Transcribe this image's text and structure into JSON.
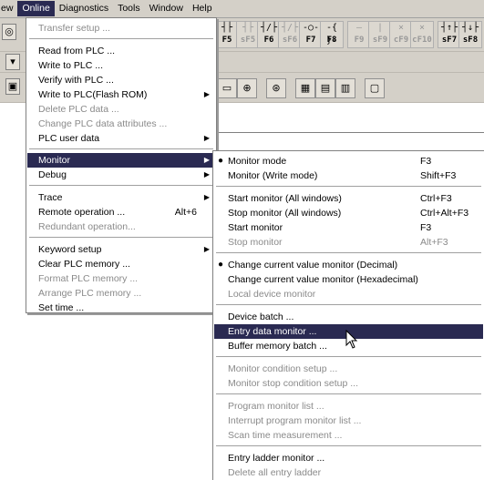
{
  "menubar": {
    "items": [
      {
        "label": "ew"
      },
      {
        "label": "Online"
      },
      {
        "label": "Diagnostics"
      },
      {
        "label": "Tools"
      },
      {
        "label": "Window"
      },
      {
        "label": "Help"
      }
    ]
  },
  "toolbar": {
    "function_keys": [
      {
        "symbol": "┤├",
        "label": "F5"
      },
      {
        "symbol": "┤├",
        "label": "sF5"
      },
      {
        "symbol": "┤/├",
        "label": "F6"
      },
      {
        "symbol": "┤/├",
        "label": "sF6"
      },
      {
        "symbol": "-○-",
        "label": "F7"
      },
      {
        "symbol": "-{ }-",
        "label": "F8"
      },
      {
        "symbol": "—",
        "label": "F9"
      },
      {
        "symbol": "|",
        "label": "sF9"
      },
      {
        "symbol": "⨯",
        "label": "cF9"
      },
      {
        "symbol": "⨯",
        "label": "cF10"
      },
      {
        "symbol": "┤↑├",
        "label": "sF7"
      },
      {
        "symbol": "┤↓├",
        "label": "sF8"
      }
    ]
  },
  "online_menu": {
    "items": [
      {
        "label": "Transfer setup ...",
        "enabled": false
      },
      {
        "label": "Read from PLC ...",
        "enabled": true
      },
      {
        "label": "Write to PLC ...",
        "enabled": true
      },
      {
        "label": "Verify with PLC ...",
        "enabled": true
      },
      {
        "label": "Write to PLC(Flash ROM)",
        "enabled": true,
        "submenu": true
      },
      {
        "label": "Delete PLC data ...",
        "enabled": false
      },
      {
        "label": "Change PLC data attributes ...",
        "enabled": false
      },
      {
        "label": "PLC user data",
        "enabled": true,
        "submenu": true
      },
      {
        "label": "Monitor",
        "enabled": true,
        "submenu": true,
        "highlighted": true
      },
      {
        "label": "Debug",
        "enabled": true,
        "submenu": true
      },
      {
        "label": "Trace",
        "enabled": true,
        "submenu": true
      },
      {
        "label": "Remote operation ...",
        "enabled": true,
        "shortcut": "Alt+6"
      },
      {
        "label": "Redundant operation...",
        "enabled": false
      },
      {
        "label": "Keyword setup",
        "enabled": true,
        "submenu": true
      },
      {
        "label": "Clear PLC memory ...",
        "enabled": true
      },
      {
        "label": "Format PLC memory ...",
        "enabled": false
      },
      {
        "label": "Arrange PLC memory ...",
        "enabled": false
      },
      {
        "label": "Set time ...",
        "enabled": true
      }
    ]
  },
  "monitor_menu": {
    "items": [
      {
        "label": "Monitor mode",
        "shortcut": "F3",
        "enabled": true,
        "checked": true
      },
      {
        "label": "Monitor (Write mode)",
        "shortcut": "Shift+F3",
        "enabled": true
      },
      {
        "label": "Start monitor (All windows)",
        "shortcut": "Ctrl+F3",
        "enabled": true
      },
      {
        "label": "Stop monitor (All windows)",
        "shortcut": "Ctrl+Alt+F3",
        "enabled": true
      },
      {
        "label": "Start monitor",
        "shortcut": "F3",
        "enabled": true
      },
      {
        "label": "Stop monitor",
        "shortcut": "Alt+F3",
        "enabled": false
      },
      {
        "label": "Change current value monitor (Decimal)",
        "enabled": true,
        "checked": true
      },
      {
        "label": "Change current value monitor (Hexadecimal)",
        "enabled": true
      },
      {
        "label": "Local device monitor",
        "enabled": false
      },
      {
        "label": "Device batch ...",
        "enabled": true
      },
      {
        "label": "Entry data monitor ...",
        "enabled": true,
        "highlighted": true
      },
      {
        "label": "Buffer memory batch ...",
        "enabled": true
      },
      {
        "label": "Monitor condition setup ...",
        "enabled": false
      },
      {
        "label": "Monitor stop condition setup ...",
        "enabled": false
      },
      {
        "label": "Program monitor list ...",
        "enabled": false
      },
      {
        "label": "Interrupt program monitor list ...",
        "enabled": false
      },
      {
        "label": "Scan time measurement ...",
        "enabled": false
      },
      {
        "label": "Entry ladder monitor ...",
        "enabled": true
      },
      {
        "label": "Delete all entry ladder",
        "enabled": false
      }
    ]
  },
  "colors": {
    "highlight": "#2a2a52",
    "disabled_text": "#8a8a8a",
    "chrome": "#d4d0c8"
  }
}
